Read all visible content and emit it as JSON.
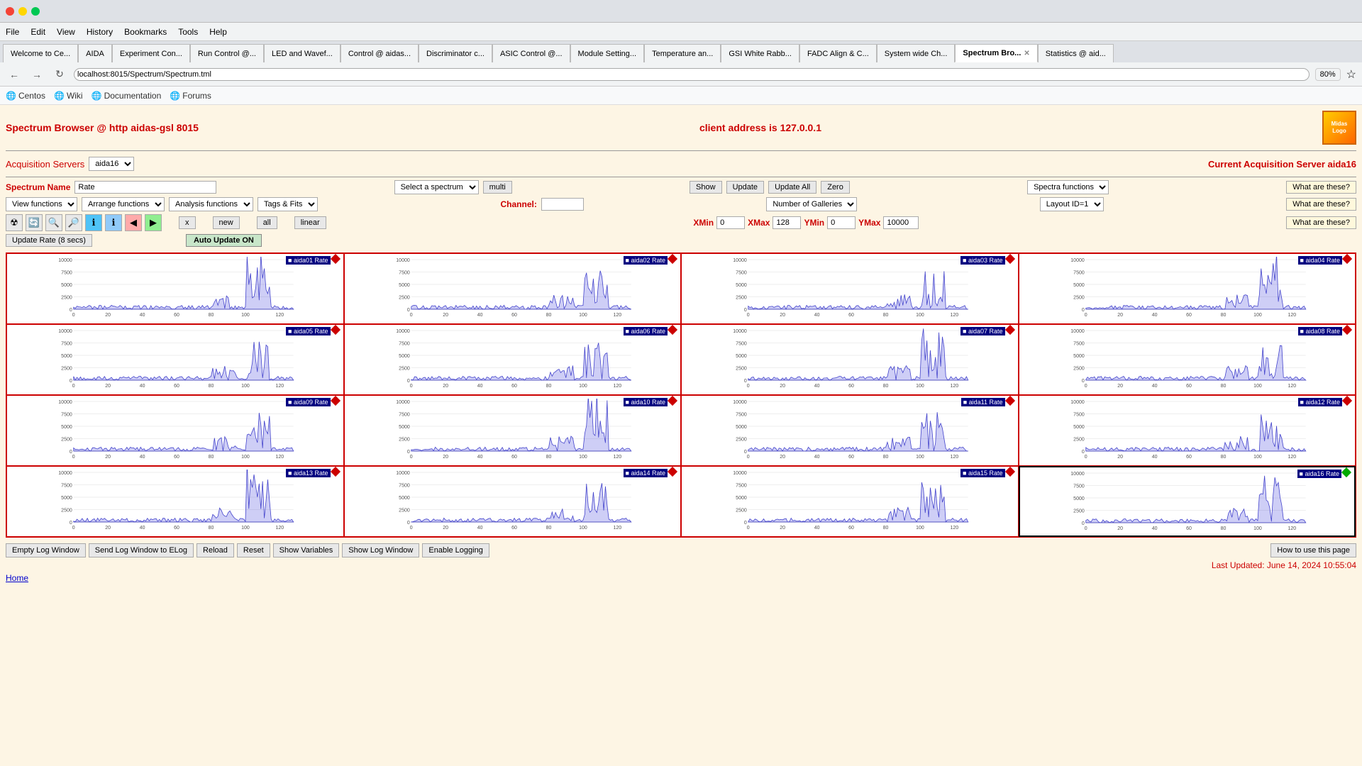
{
  "browser": {
    "tabs": [
      {
        "label": "Welcome to Ce...",
        "active": false
      },
      {
        "label": "AIDA",
        "active": false
      },
      {
        "label": "Experiment Con...",
        "active": false
      },
      {
        "label": "Run Control @...",
        "active": false
      },
      {
        "label": "LED and Wavef...",
        "active": false
      },
      {
        "label": "Control @ aidas...",
        "active": false
      },
      {
        "label": "Discriminator c...",
        "active": false
      },
      {
        "label": "ASIC Control @...",
        "active": false
      },
      {
        "label": "Module Setting...",
        "active": false
      },
      {
        "label": "Temperature an...",
        "active": false
      },
      {
        "label": "GSI White Rabb...",
        "active": false
      },
      {
        "label": "FADC Align & C...",
        "active": false
      },
      {
        "label": "System wide Ch...",
        "active": false
      },
      {
        "label": "Spectrum Bro...",
        "active": true,
        "closable": true
      },
      {
        "label": "Statistics @ aid...",
        "active": false
      }
    ],
    "url": "localhost:8015/Spectrum/Spectrum.tml",
    "zoom": "80%",
    "menu": [
      "File",
      "Edit",
      "View",
      "History",
      "Bookmarks",
      "Tools",
      "Help"
    ],
    "bookmarks": [
      "Centos",
      "Wiki",
      "Documentation",
      "Forums"
    ]
  },
  "page": {
    "title": "Spectrum Browser @ http aidas-gsl 8015",
    "client_address": "client address is 127.0.0.1",
    "acq_label": "Acquisition Servers",
    "acq_server": "aida16",
    "current_acq_label": "Current Acquisition Server aida16",
    "spectrum_name_label": "Spectrum Name",
    "spectrum_name_value": "Rate",
    "select_spectrum_label": "Select a spectrum",
    "multi_label": "multi",
    "show_label": "Show",
    "update_label": "Update",
    "update_all_label": "Update All",
    "zero_label": "Zero",
    "spectra_functions_label": "Spectra functions",
    "what_these_1": "What are these?",
    "view_functions_label": "View functions",
    "arrange_functions_label": "Arrange functions",
    "analysis_functions_label": "Analysis functions",
    "tags_fits_label": "Tags & Fits",
    "channel_label": "Channel:",
    "channel_value": "",
    "number_galleries_label": "Number of Galleries",
    "layout_id_label": "Layout ID=1",
    "what_these_2": "What are these?",
    "x_btn": "x",
    "new_btn": "new",
    "all_btn": "all",
    "linear_btn": "linear",
    "xmin_label": "XMin",
    "xmin_value": "0",
    "xmax_label": "XMax",
    "xmax_value": "128",
    "ymin_label": "YMin",
    "ymin_value": "0",
    "ymax_label": "YMax",
    "ymax_value": "10000",
    "what_these_3": "What are these?",
    "update_rate_label": "Update Rate (8 secs)",
    "auto_update_label": "Auto Update ON",
    "last_updated": "Last Updated: June 14, 2024 10:55:04",
    "home_link": "Home",
    "how_to_use": "How to use this page"
  },
  "log_buttons": [
    {
      "label": "Empty Log Window",
      "name": "empty-log-btn"
    },
    {
      "label": "Send Log Window to ELog",
      "name": "send-log-btn"
    },
    {
      "label": "Reload",
      "name": "reload-btn"
    },
    {
      "label": "Reset",
      "name": "reset-btn"
    },
    {
      "label": "Show Variables",
      "name": "show-variables-btn"
    },
    {
      "label": "Show Log Window",
      "name": "show-log-btn"
    },
    {
      "label": "Enable Logging",
      "name": "enable-logging-btn"
    }
  ],
  "galleries": [
    {
      "id": "aida01",
      "label": "aida01 Rate",
      "diamond": "red"
    },
    {
      "id": "aida02",
      "label": "aida02 Rate",
      "diamond": "red"
    },
    {
      "id": "aida03",
      "label": "aida03 Rate",
      "diamond": "red"
    },
    {
      "id": "aida04",
      "label": "aida04 Rate",
      "diamond": "red"
    },
    {
      "id": "aida05",
      "label": "aida05 Rate",
      "diamond": "red"
    },
    {
      "id": "aida06",
      "label": "aida06 Rate",
      "diamond": "red"
    },
    {
      "id": "aida07",
      "label": "aida07 Rate",
      "diamond": "red"
    },
    {
      "id": "aida08",
      "label": "aida08 Rate",
      "diamond": "red"
    },
    {
      "id": "aida09",
      "label": "aida09 Rate",
      "diamond": "red"
    },
    {
      "id": "aida10",
      "label": "aida10 Rate",
      "diamond": "red"
    },
    {
      "id": "aida11",
      "label": "aida11 Rate",
      "diamond": "red"
    },
    {
      "id": "aida12",
      "label": "aida12 Rate",
      "diamond": "red"
    },
    {
      "id": "aida13",
      "label": "aida13 Rate",
      "diamond": "red"
    },
    {
      "id": "aida14",
      "label": "aida14 Rate",
      "diamond": "red"
    },
    {
      "id": "aida15",
      "label": "aida15 Rate",
      "diamond": "red"
    },
    {
      "id": "aida16",
      "label": "aida16 Rate",
      "diamond": "green",
      "highlight": true
    }
  ],
  "colors": {
    "accent_red": "#cc0000",
    "background": "#fdf5e4",
    "chart_line": "#4444ff",
    "chart_bg": "#ffffff"
  }
}
